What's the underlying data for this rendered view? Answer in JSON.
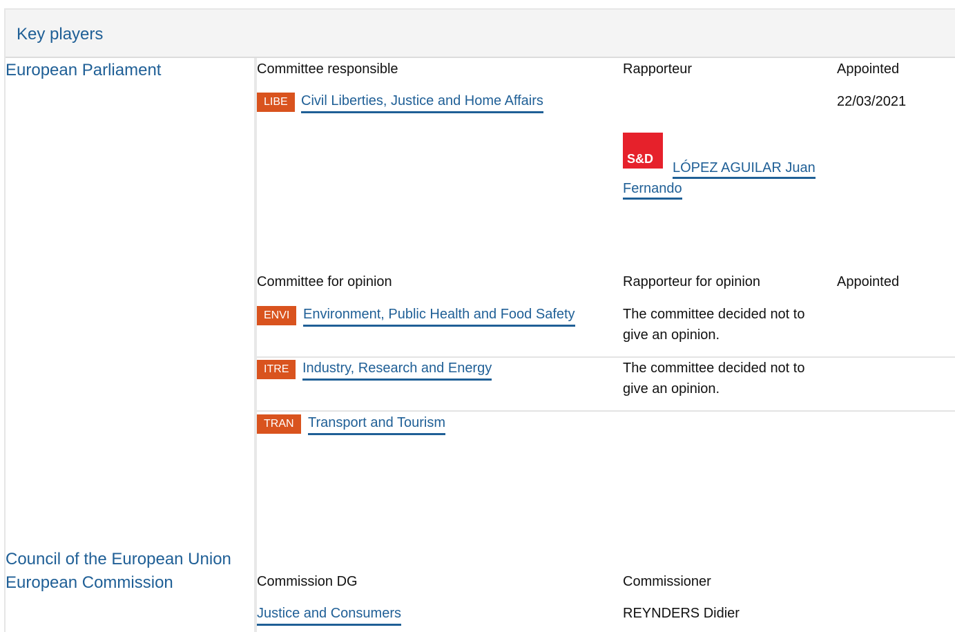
{
  "header": {
    "title": "Key players"
  },
  "parliament": {
    "title": "European Parliament",
    "responsible": {
      "col_committee": "Committee responsible",
      "col_rapporteur": "Rapporteur",
      "col_appointed": "Appointed",
      "committee_abbr": "LIBE",
      "committee_name": "Civil Liberties, Justice and Home Affairs",
      "appointed_date": "22/03/2021",
      "party_logo": "S&D",
      "rapporteur_line1": "LÓPEZ AGUILAR Juan",
      "rapporteur_line2": "Fernando"
    },
    "opinion": {
      "col_committee": "Committee for opinion",
      "col_rapporteur": "Rapporteur for opinion",
      "col_appointed": "Appointed",
      "rows": [
        {
          "abbr": "ENVI",
          "name": "Environment, Public Health and Food Safety",
          "note_line1": "The committee decided not to",
          "note_line2": "give an opinion."
        },
        {
          "abbr": "ITRE",
          "name": "Industry, Research and Energy",
          "note_line1": "The committee decided not to",
          "note_line2": "give an opinion."
        },
        {
          "abbr": "TRAN",
          "name": "Transport and Tourism",
          "note_line1": "",
          "note_line2": ""
        }
      ]
    }
  },
  "council": {
    "title": "Council of the European Union"
  },
  "commission": {
    "title": "European Commission",
    "col_dg": "Commission DG",
    "col_commissioner": "Commissioner",
    "dg_name": "Justice and Consumers",
    "commissioner_name": "REYNDERS Didier"
  },
  "colors": {
    "link": "#1f5f96",
    "badge": "#d9531e",
    "party_sd": "#e6212b"
  }
}
